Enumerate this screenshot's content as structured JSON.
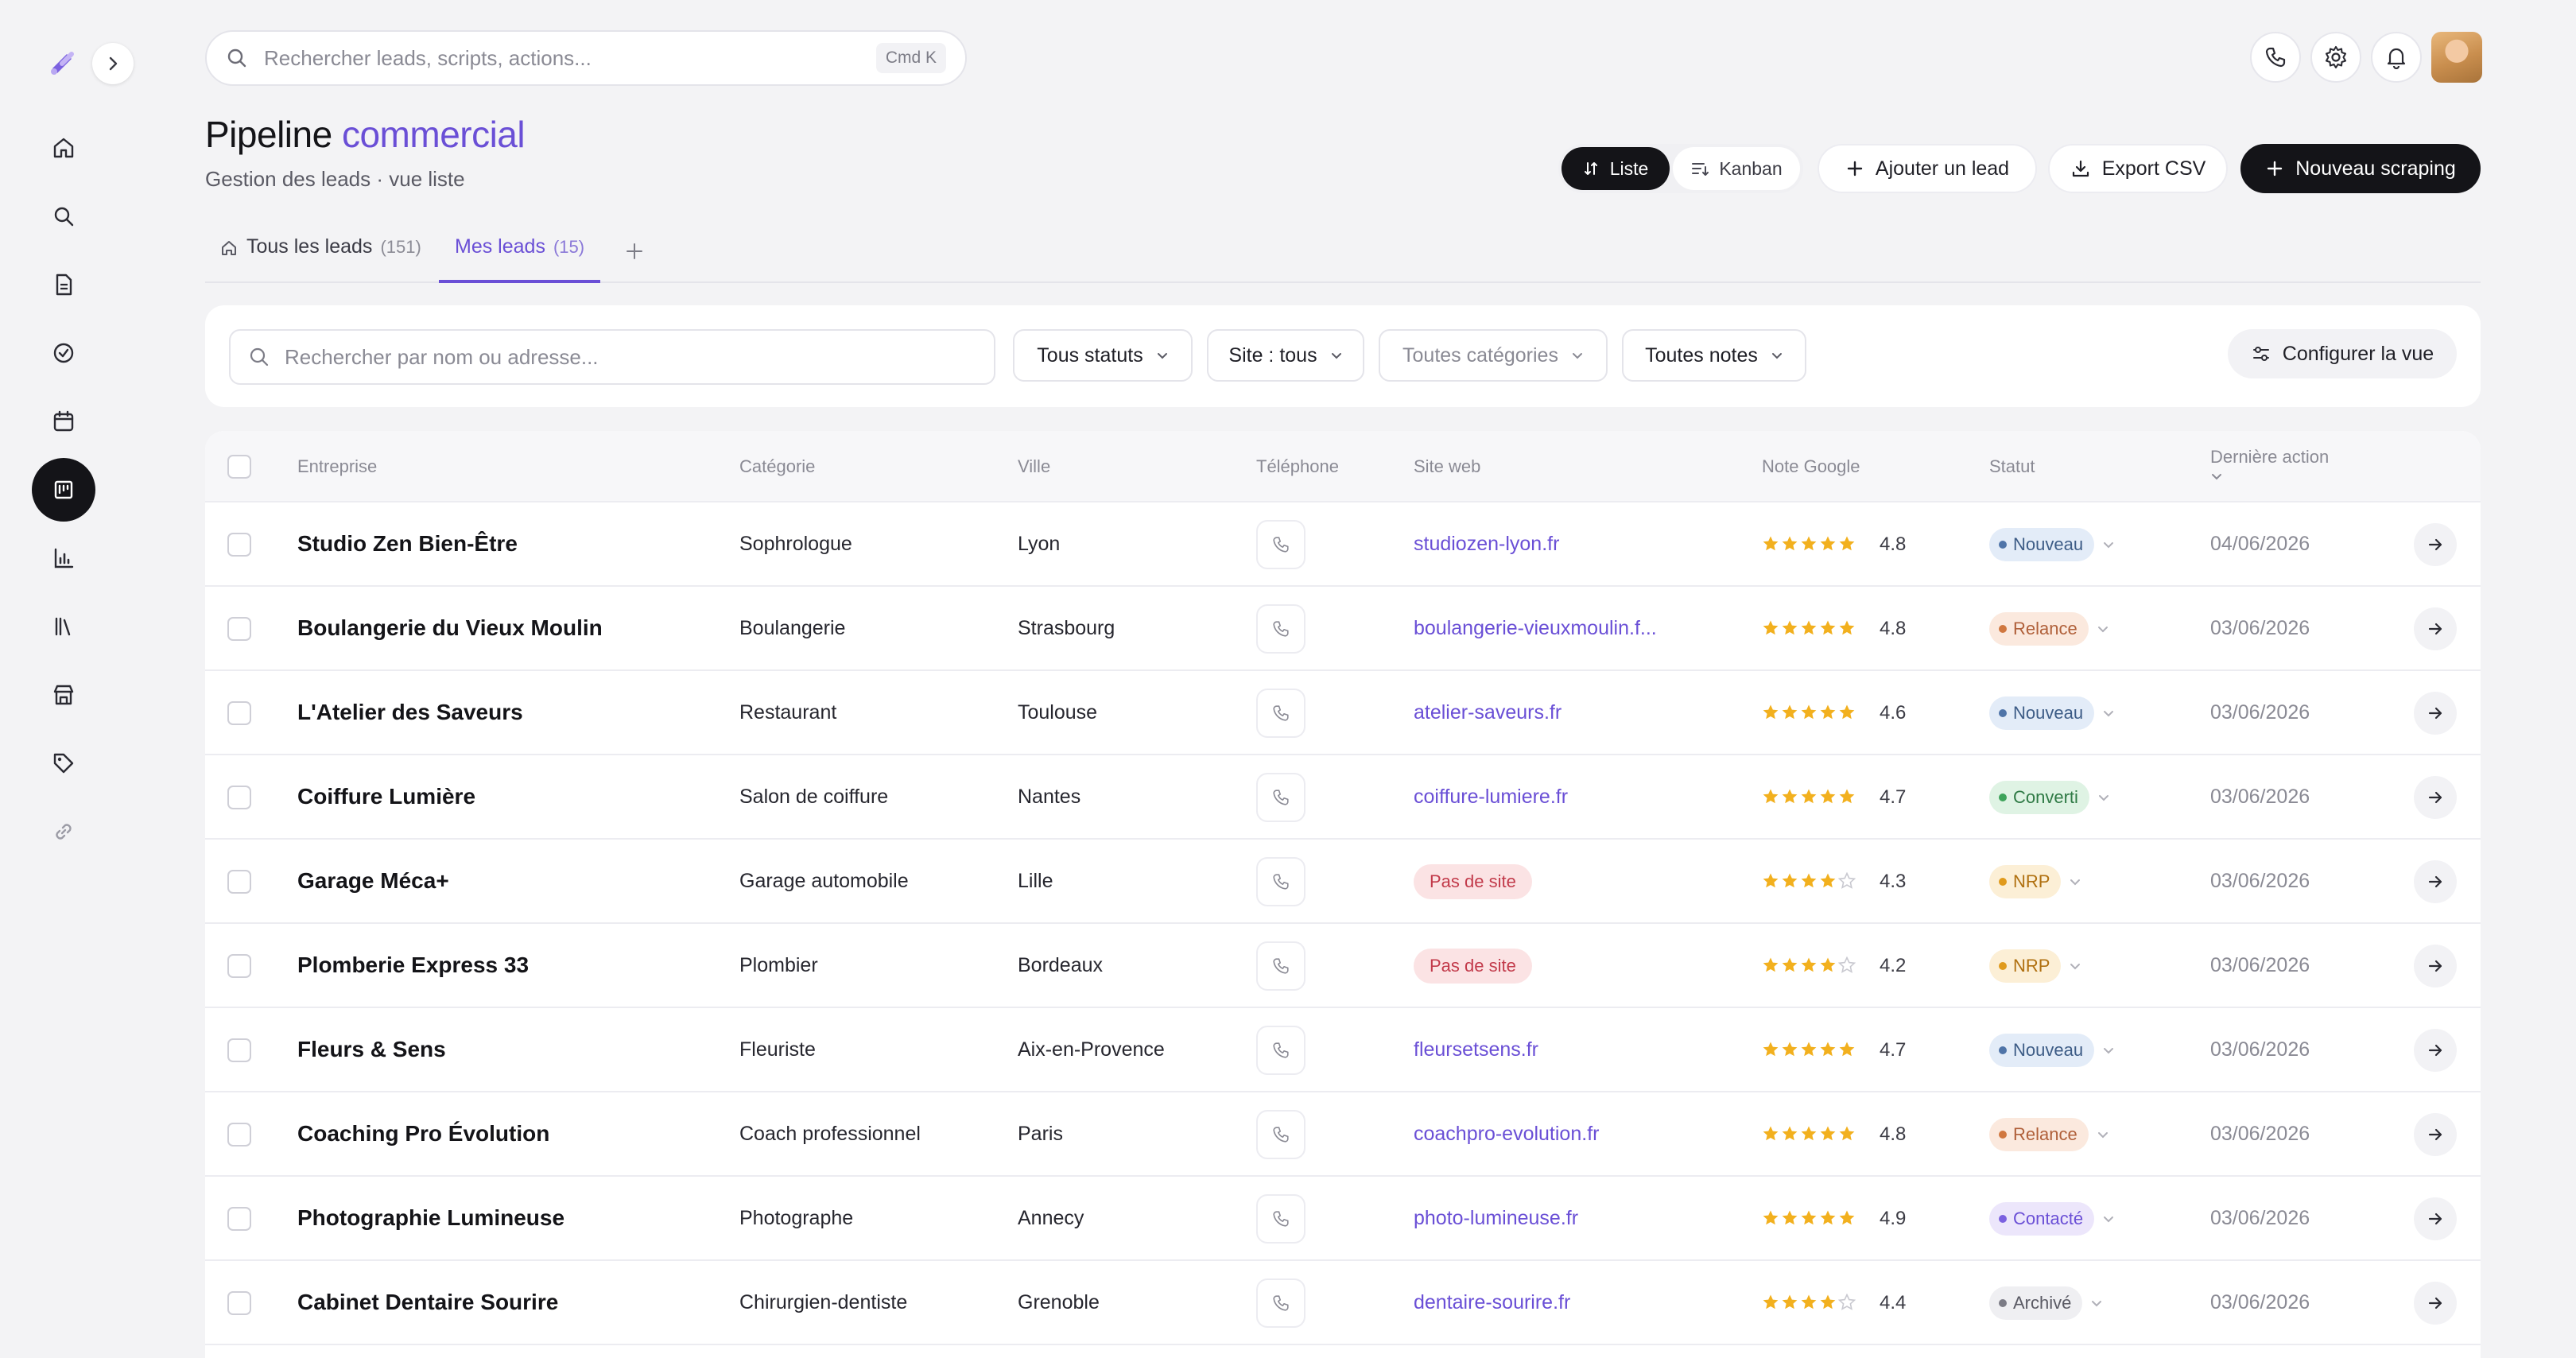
{
  "search": {
    "placeholder": "Rechercher leads, scripts, actions...",
    "shortcut": "Cmd K"
  },
  "sidebar": {
    "items": [
      {
        "name": "home-icon"
      },
      {
        "name": "search-icon"
      },
      {
        "name": "document-icon"
      },
      {
        "name": "check-circle-icon"
      },
      {
        "name": "calendar-icon"
      },
      {
        "name": "pipeline-icon",
        "active": true
      },
      {
        "name": "bar-chart-icon"
      },
      {
        "name": "library-icon"
      },
      {
        "name": "store-icon"
      },
      {
        "name": "tag-icon"
      },
      {
        "name": "link-icon"
      }
    ]
  },
  "header": {
    "title_main": "Pipeline",
    "title_accent": "commercial",
    "subtitle": "Gestion des leads · vue liste"
  },
  "actions": {
    "view_list": "Liste",
    "view_kanban": "Kanban",
    "add_lead": "Ajouter un lead",
    "export_csv": "Export CSV",
    "new_scraping": "Nouveau scraping"
  },
  "tabs": [
    {
      "label": "Tous les leads",
      "count": "(151)"
    },
    {
      "label": "Mes leads",
      "count": "(15)"
    }
  ],
  "filters": {
    "search_placeholder": "Rechercher par nom ou adresse...",
    "status": "Tous statuts",
    "site": "Site : tous",
    "category": "Toutes catégories",
    "rating": "Toutes notes",
    "configure": "Configurer la vue"
  },
  "table": {
    "columns": [
      "Entreprise",
      "Catégorie",
      "Ville",
      "Téléphone",
      "Site web",
      "Note Google",
      "Statut",
      "Dernière action"
    ],
    "rows": [
      {
        "company": "Studio Zen Bien-Être",
        "category": "Sophrologue",
        "city": "Lyon",
        "website": "studiozen-lyon.fr",
        "stars": 5,
        "rating": "4.8",
        "status": "Nouveau",
        "date": "04/06/2026"
      },
      {
        "company": "Boulangerie du Vieux Moulin",
        "category": "Boulangerie",
        "city": "Strasbourg",
        "website": "boulangerie-vieuxmoulin.f...",
        "stars": 5,
        "rating": "4.8",
        "status": "Relance",
        "date": "03/06/2026"
      },
      {
        "company": "L'Atelier des Saveurs",
        "category": "Restaurant",
        "city": "Toulouse",
        "website": "atelier-saveurs.fr",
        "stars": 5,
        "rating": "4.6",
        "status": "Nouveau",
        "date": "03/06/2026"
      },
      {
        "company": "Coiffure Lumière",
        "category": "Salon de coiffure",
        "city": "Nantes",
        "website": "coiffure-lumiere.fr",
        "stars": 5,
        "rating": "4.7",
        "status": "Converti",
        "date": "03/06/2026"
      },
      {
        "company": "Garage Méca+",
        "category": "Garage automobile",
        "city": "Lille",
        "website": null,
        "no_site": "Pas de site",
        "stars": 4,
        "rating": "4.3",
        "status": "NRP",
        "date": "03/06/2026"
      },
      {
        "company": "Plomberie Express 33",
        "category": "Plombier",
        "city": "Bordeaux",
        "website": null,
        "no_site": "Pas de site",
        "stars": 4,
        "rating": "4.2",
        "status": "NRP",
        "date": "03/06/2026"
      },
      {
        "company": "Fleurs & Sens",
        "category": "Fleuriste",
        "city": "Aix-en-Provence",
        "website": "fleursetsens.fr",
        "stars": 5,
        "rating": "4.7",
        "status": "Nouveau",
        "date": "03/06/2026"
      },
      {
        "company": "Coaching Pro Évolution",
        "category": "Coach professionnel",
        "city": "Paris",
        "website": "coachpro-evolution.fr",
        "stars": 5,
        "rating": "4.8",
        "status": "Relance",
        "date": "03/06/2026"
      },
      {
        "company": "Photographie Lumineuse",
        "category": "Photographe",
        "city": "Annecy",
        "website": "photo-lumineuse.fr",
        "stars": 5,
        "rating": "4.9",
        "status": "Contacté",
        "date": "03/06/2026"
      },
      {
        "company": "Cabinet Dentaire Sourire",
        "category": "Chirurgien-dentiste",
        "city": "Grenoble",
        "website": "dentaire-sourire.fr",
        "stars": 4,
        "rating": "4.4",
        "status": "Archivé",
        "date": "03/06/2026"
      }
    ]
  },
  "status_colors": {
    "Nouveau": {
      "bg": "#e3ecf8",
      "fg": "#3d5c86",
      "dot": "#4f74a8"
    },
    "Relance": {
      "bg": "#fbe9de",
      "fg": "#b0603a",
      "dot": "#d0773f"
    },
    "Converti": {
      "bg": "#dff3e4",
      "fg": "#2f7a45",
      "dot": "#3da35a"
    },
    "NRP": {
      "bg": "#fcefd6",
      "fg": "#b07010",
      "dot": "#e09a1c"
    },
    "Contacté": {
      "bg": "#ece6fb",
      "fg": "#6a4fd6",
      "dot": "#7b61e0"
    },
    "Archivé": {
      "bg": "#efeff2",
      "fg": "#5a5a64",
      "dot": "#7c7c86"
    }
  },
  "colors": {
    "accent": "#6a4fd6",
    "star": "#f2b01e",
    "star_empty": "#c9c9d0",
    "dark": "#141418"
  }
}
